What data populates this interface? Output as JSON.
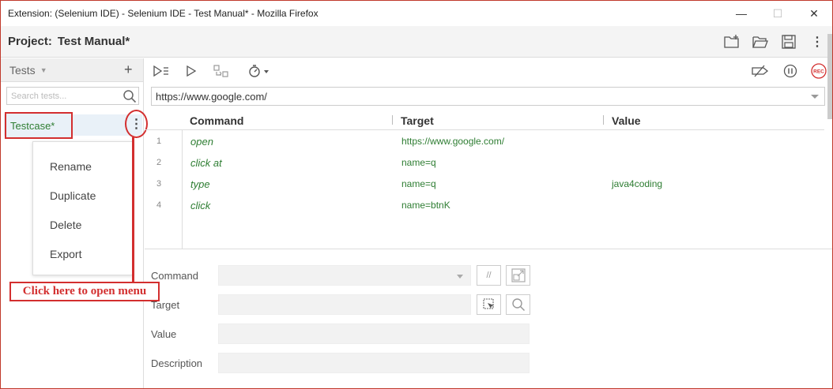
{
  "window": {
    "title": "Extension: (Selenium IDE) - Selenium IDE - Test Manual* - Mozilla Firefox",
    "minimize": "—",
    "maximize": "☐",
    "close": "✕"
  },
  "project": {
    "label": "Project:",
    "name": "Test Manual*"
  },
  "sidebar": {
    "header": "Tests",
    "add": "+",
    "search_placeholder": "Search tests...",
    "test_name": "Testcase*",
    "kebab": "⋮",
    "menu": [
      "Rename",
      "Duplicate",
      "Delete",
      "Export"
    ],
    "callout": "Click here to open menu"
  },
  "url": "https://www.google.com/",
  "grid": {
    "headers": [
      "Command",
      "Target",
      "Value"
    ],
    "rows": [
      {
        "num": "1",
        "command": "open",
        "target": "https://www.google.com/",
        "value": ""
      },
      {
        "num": "2",
        "command": "click at",
        "target": "name=q",
        "value": ""
      },
      {
        "num": "3",
        "command": "type",
        "target": "name=q",
        "value": "java4coding"
      },
      {
        "num": "4",
        "command": "click",
        "target": "name=btnK",
        "value": ""
      }
    ]
  },
  "form": {
    "command_label": "Command",
    "target_label": "Target",
    "value_label": "Value",
    "description_label": "Description",
    "comment_btn": "//"
  },
  "rec_label": "REC",
  "colors": {
    "accent_red": "#d32f2f",
    "command_green": "#2e7d32"
  }
}
